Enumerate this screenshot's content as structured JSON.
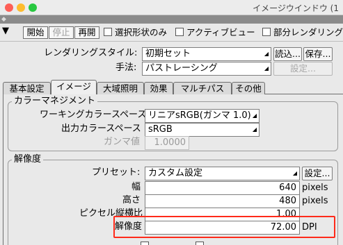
{
  "window": {
    "title": "イメージウインドウ (1",
    "traffic_lights": {
      "close": "#fe5f57",
      "minimize": "#febc2e",
      "maximize": "#28c840"
    }
  },
  "toolbar": {
    "start_label": "開始",
    "stop_label": "停止",
    "resume_label": "再開",
    "selection_only_label": "選択形状のみ",
    "active_view_label": "アクティブビュー",
    "partial_render_label": "部分レンダリング"
  },
  "rendering": {
    "style_label": "レンダリングスタイル:",
    "style_value": "初期セット",
    "load_label": "読込...",
    "save_label": "保存...",
    "method_label": "手法:",
    "method_value": "パストレーシング",
    "settings_label": "設定..."
  },
  "tabs": [
    "基本設定",
    "イメージ",
    "大域照明",
    "効果",
    "マルチパス",
    "その他"
  ],
  "active_tab": "イメージ",
  "color_management": {
    "title": "カラーマネジメント",
    "working_label": "ワーキングカラースペース",
    "working_value": "リニアsRGB(ガンマ 1.0)",
    "output_label": "出力カラースペース",
    "output_value": "sRGB",
    "gamma_label": "ガンマ値",
    "gamma_value": "1.0000"
  },
  "resolution": {
    "title": "解像度",
    "preset_label": "プリセット:",
    "preset_value": "カスタム設定",
    "preset_button": "設定...",
    "width_label": "幅",
    "width_value": "640",
    "width_unit": "pixels",
    "height_label": "高さ",
    "height_value": "480",
    "height_unit": "pixels",
    "aspect_label": "ピクセル縦横比",
    "aspect_value": "1.00",
    "dpi_label": "解像度",
    "dpi_value": "72.00",
    "dpi_unit": "DPI"
  },
  "highlight_color": "#ff2a1a"
}
